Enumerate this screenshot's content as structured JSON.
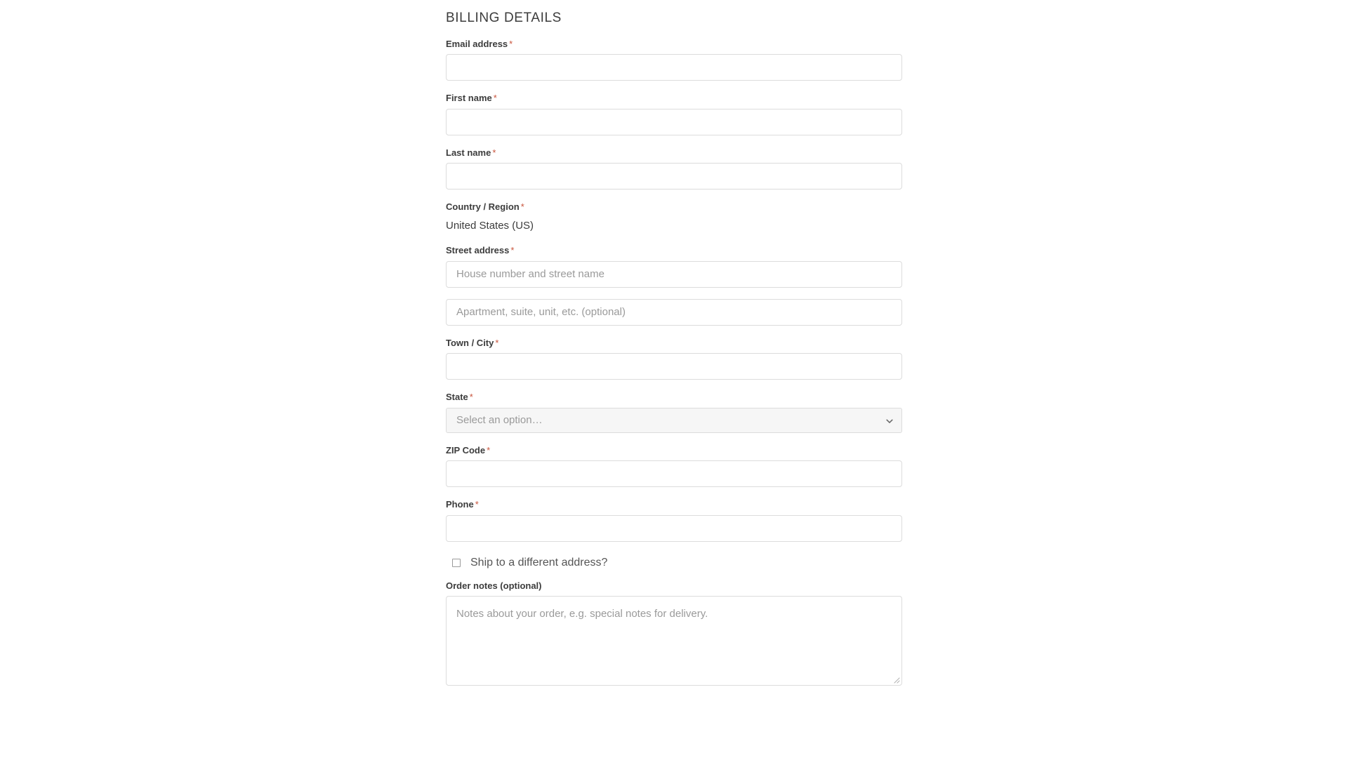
{
  "heading": "BILLING DETAILS",
  "required_marker": "*",
  "required_color": "#c9553d",
  "fields": [
    {
      "name": "email",
      "label": "Email address",
      "required": true,
      "type": "text",
      "value": "",
      "placeholder": ""
    },
    {
      "name": "first-name",
      "label": "First name",
      "required": true,
      "type": "text",
      "value": "",
      "placeholder": ""
    },
    {
      "name": "last-name",
      "label": "Last name",
      "required": true,
      "type": "text",
      "value": "",
      "placeholder": ""
    },
    {
      "name": "country-region",
      "label": "Country / Region",
      "required": true,
      "type": "static",
      "value": "United States (US)"
    },
    {
      "name": "street-address",
      "label": "Street address",
      "required": true,
      "type": "text",
      "value": "",
      "placeholder": "House number and street name"
    },
    {
      "name": "address-line-2",
      "label": "",
      "required": false,
      "type": "text",
      "value": "",
      "placeholder": "Apartment, suite, unit, etc. (optional)"
    },
    {
      "name": "town-city",
      "label": "Town / City",
      "required": true,
      "type": "text",
      "value": "",
      "placeholder": ""
    },
    {
      "name": "state",
      "label": "State",
      "required": true,
      "type": "select",
      "value": "Select an option…",
      "icon": "chevron-down-icon"
    },
    {
      "name": "zip-code",
      "label": "ZIP Code",
      "required": true,
      "type": "text",
      "value": "",
      "placeholder": ""
    },
    {
      "name": "phone",
      "label": "Phone",
      "required": true,
      "type": "text",
      "value": "",
      "placeholder": ""
    }
  ],
  "ship_different": {
    "label": "Ship to a different address?",
    "checked": false
  },
  "order_notes": {
    "label": "Order notes (optional)",
    "placeholder": "Notes about your order, e.g. special notes for delivery.",
    "value": "",
    "resize_handle_icon": "resize-grip-icon"
  }
}
